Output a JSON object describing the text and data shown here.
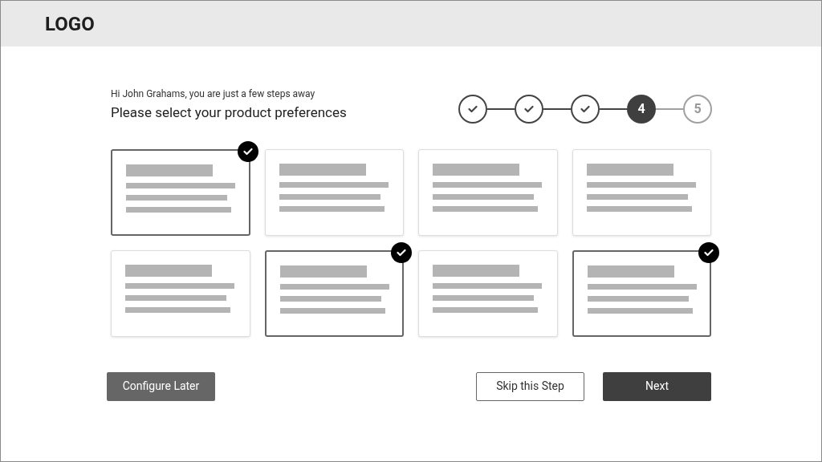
{
  "header": {
    "logo": "LOGO"
  },
  "intro": {
    "greeting": "Hi John Grahams, you are just a few steps away",
    "heading": "Please select your product preferences"
  },
  "steps": [
    {
      "kind": "done"
    },
    {
      "kind": "done"
    },
    {
      "kind": "done"
    },
    {
      "kind": "current",
      "label": "4"
    },
    {
      "kind": "pending",
      "label": "5"
    }
  ],
  "cards": [
    {
      "selected": true
    },
    {
      "selected": false
    },
    {
      "selected": false
    },
    {
      "selected": false
    },
    {
      "selected": false
    },
    {
      "selected": true
    },
    {
      "selected": false
    },
    {
      "selected": true
    }
  ],
  "buttons": {
    "configure_later": "Configure Later",
    "skip": "Skip this Step",
    "next": "Next"
  }
}
